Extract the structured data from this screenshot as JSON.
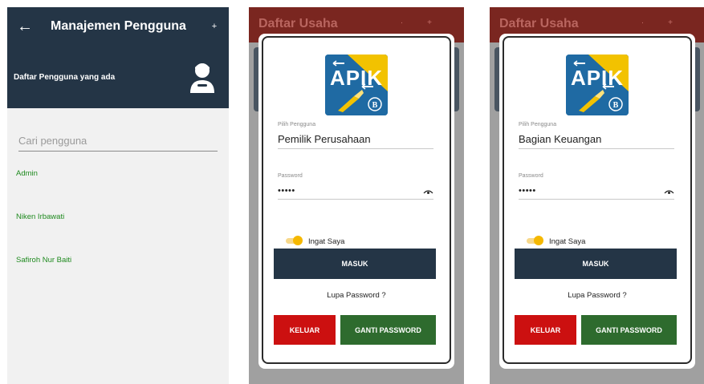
{
  "screen1": {
    "title": "Manajemen Pengguna",
    "back_icon": "arrow-left-icon",
    "plus_icon": "plus-icon",
    "header_label": "Daftar Pengguna yang ada",
    "avatar_icon": "user-avatar-icon",
    "search_placeholder": "Cari pengguna",
    "users": [
      "Admin",
      "Niken Irbawati",
      "Safiroh Nur Baiti"
    ]
  },
  "screen2": {
    "background_title": "Daftar Usaha",
    "logo_text": "APIK",
    "user_label": "Pilih Pengguna",
    "user_value": "Pemilik Perusahaan",
    "password_label": "Password",
    "password_value": "•••••",
    "eye_icon": "eye-icon",
    "remember_label": "Ingat Saya",
    "login_button": "MASUK",
    "forgot_link": "Lupa Password ?",
    "exit_button": "KELUAR",
    "change_password_button": "GANTI PASSWORD"
  },
  "screen3": {
    "background_title": "Daftar Usaha",
    "logo_text": "APIK",
    "user_label": "Pilih Pengguna",
    "user_value": "Bagian Keuangan",
    "password_label": "Password",
    "password_value": "•••••",
    "eye_icon": "eye-icon",
    "remember_label": "Ingat Saya",
    "login_button": "MASUK",
    "forgot_link": "Lupa Password ?",
    "exit_button": "KELUAR",
    "change_password_button": "GANTI PASSWORD"
  },
  "colors": {
    "navy": "#243546",
    "green_text": "#1f8a1f",
    "red_button": "#cc1010",
    "green_button": "#2e6b2e",
    "toggle_accent": "#f5b800",
    "logo_blue": "#1f6aa3"
  }
}
